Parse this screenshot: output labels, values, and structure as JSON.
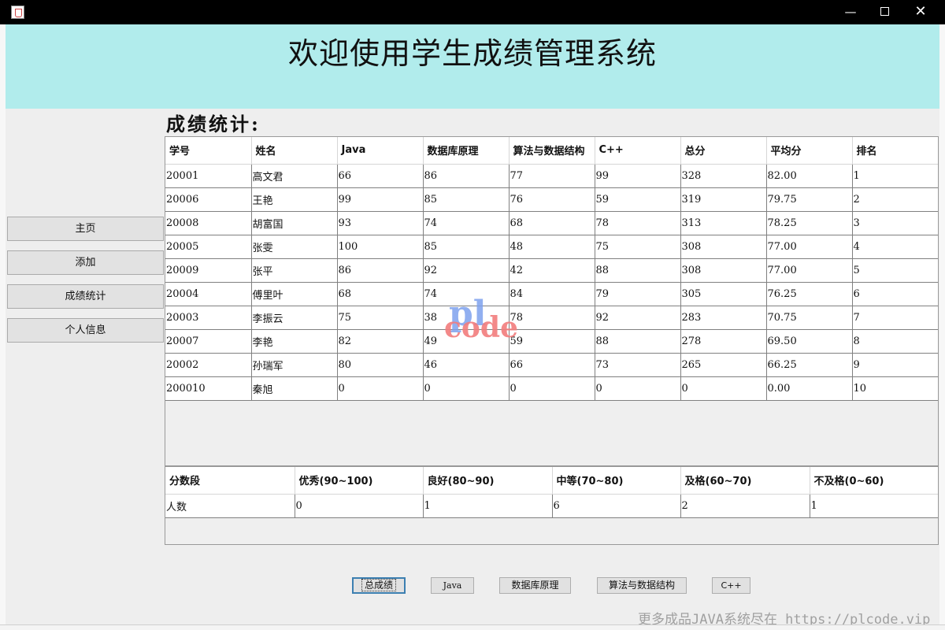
{
  "window": {
    "minimize": "—",
    "close": "✕"
  },
  "header": {
    "title": "欢迎使用学生成绩管理系统"
  },
  "sidebar": {
    "items": [
      {
        "label": "主页"
      },
      {
        "label": "添加"
      },
      {
        "label": "成绩统计"
      },
      {
        "label": "个人信息"
      }
    ]
  },
  "section_title": "成绩统计:",
  "scores_table": {
    "columns": [
      "学号",
      "姓名",
      "Java",
      "数据库原理",
      "算法与数据结构",
      "C++",
      "总分",
      "平均分",
      "排名"
    ],
    "rows": [
      [
        "20001",
        "高文君",
        "66",
        "86",
        "77",
        "99",
        "328",
        "82.00",
        "1"
      ],
      [
        "20006",
        "王艳",
        "99",
        "85",
        "76",
        "59",
        "319",
        "79.75",
        "2"
      ],
      [
        "20008",
        "胡富国",
        "93",
        "74",
        "68",
        "78",
        "313",
        "78.25",
        "3"
      ],
      [
        "20005",
        "张雯",
        "100",
        "85",
        "48",
        "75",
        "308",
        "77.00",
        "4"
      ],
      [
        "20009",
        "张平",
        "86",
        "92",
        "42",
        "88",
        "308",
        "77.00",
        "5"
      ],
      [
        "20004",
        "傅里叶",
        "68",
        "74",
        "84",
        "79",
        "305",
        "76.25",
        "6"
      ],
      [
        "20003",
        "李振云",
        "75",
        "38",
        "78",
        "92",
        "283",
        "70.75",
        "7"
      ],
      [
        "20007",
        "李艳",
        "82",
        "49",
        "59",
        "88",
        "278",
        "69.50",
        "8"
      ],
      [
        "20002",
        "孙瑞军",
        "80",
        "46",
        "66",
        "73",
        "265",
        "66.25",
        "9"
      ],
      [
        "200010",
        "秦旭",
        "0",
        "0",
        "0",
        "0",
        "0",
        "0.00",
        "10"
      ]
    ]
  },
  "grade_table": {
    "columns": [
      "分数段",
      "优秀(90~100)",
      "良好(80~90)",
      "中等(70~80)",
      "及格(60~70)",
      "不及格(0~60)"
    ],
    "rows": [
      [
        "人数",
        "0",
        "1",
        "6",
        "2",
        "1"
      ]
    ]
  },
  "bottom_buttons": [
    {
      "label": "总成绩",
      "active": true
    },
    {
      "label": "Java",
      "active": false
    },
    {
      "label": "数据库原理",
      "active": false
    },
    {
      "label": "算法与数据结构",
      "active": false
    },
    {
      "label": "C++",
      "active": false
    }
  ],
  "watermark": {
    "pl": "pl",
    "code": "code",
    "footer": "更多成品JAVA系统尽在 https://plcode.vip"
  },
  "colors": {
    "header_bg": "#b1ecec",
    "titlebar_bg": "#000000",
    "active_button_border": "#3c7fb1"
  }
}
